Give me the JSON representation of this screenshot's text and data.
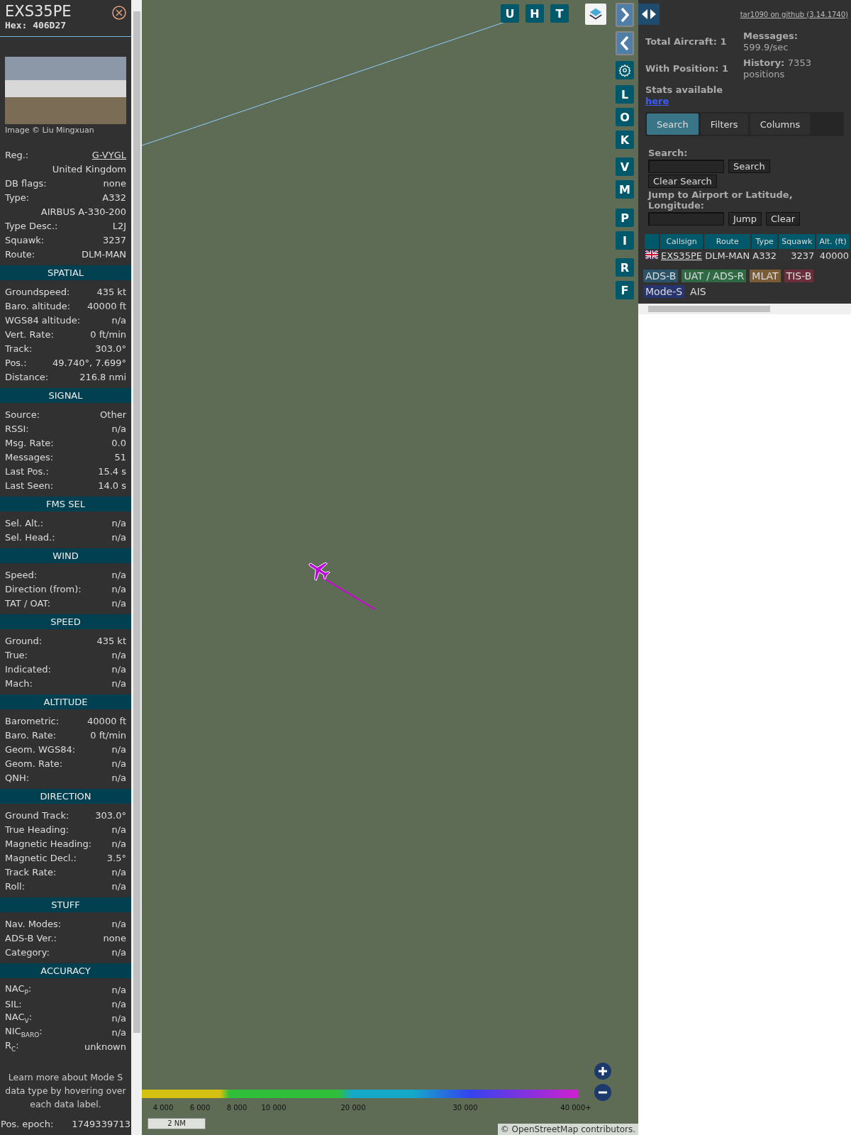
{
  "aircraft": {
    "callsign": "EXS35PE",
    "hex_label": "Hex:",
    "hex": "406D27",
    "photo_credit": "Image © Liu Mingxuan",
    "info_rows": [
      {
        "label": "Reg.:",
        "value": "G-VYGL",
        "kind": "link"
      },
      {
        "value": "United Kingdom",
        "kind": "text"
      },
      {
        "label": "DB flags:",
        "value": "none",
        "kind": "text"
      },
      {
        "label": "Type:",
        "value": "A332",
        "kind": "text"
      },
      {
        "value": "AIRBUS A-330-200",
        "kind": "text"
      },
      {
        "label": "Type Desc.:",
        "value": "L2J",
        "kind": "text"
      },
      {
        "label": "Squawk:",
        "value": "3237",
        "kind": "text"
      },
      {
        "label": "Route:",
        "value": "DLM-MAN",
        "kind": "text"
      }
    ],
    "sections": [
      {
        "title": "SPATIAL",
        "rows": [
          {
            "label": "Groundspeed:",
            "value": "435 kt"
          },
          {
            "label": "Baro. altitude:",
            "value": "40000 ft"
          },
          {
            "label": "WGS84 altitude:",
            "value": "n/a"
          },
          {
            "label": "Vert. Rate:",
            "value": "0 ft/min"
          },
          {
            "label": "Track:",
            "value": "303.0°"
          },
          {
            "label": "Pos.:",
            "value": "49.740°, 7.699°"
          },
          {
            "label": "Distance:",
            "value": "216.8 nmi"
          }
        ]
      },
      {
        "title": "SIGNAL",
        "rows": [
          {
            "label": "Source:",
            "value": "Other"
          },
          {
            "label": "RSSI:",
            "value": "n/a"
          },
          {
            "label": "Msg. Rate:",
            "value": "0.0"
          },
          {
            "label": "Messages:",
            "value": "51"
          },
          {
            "label": "Last Pos.:",
            "value": "15.4 s"
          },
          {
            "label": "Last Seen:",
            "value": "14.0 s"
          }
        ]
      },
      {
        "title": "FMS SEL",
        "rows": [
          {
            "label": "Sel. Alt.:",
            "value": "n/a"
          },
          {
            "label": "Sel. Head.:",
            "value": "n/a"
          }
        ]
      },
      {
        "title": "WIND",
        "rows": [
          {
            "label": "Speed:",
            "value": "n/a"
          },
          {
            "label": "Direction (from):",
            "value": "n/a"
          },
          {
            "label": "TAT / OAT:",
            "value": "n/a"
          }
        ]
      },
      {
        "title": "SPEED",
        "rows": [
          {
            "label": "Ground:",
            "value": "435 kt"
          },
          {
            "label": "True:",
            "value": "n/a"
          },
          {
            "label": "Indicated:",
            "value": "n/a"
          },
          {
            "label": "Mach:",
            "value": "n/a"
          }
        ]
      },
      {
        "title": "ALTITUDE",
        "rows": [
          {
            "label": "Barometric:",
            "value": "40000 ft"
          },
          {
            "label": "Baro. Rate:",
            "value": "0 ft/min"
          },
          {
            "label": "Geom. WGS84:",
            "value": "n/a"
          },
          {
            "label": "Geom. Rate:",
            "value": "n/a"
          },
          {
            "label": "QNH:",
            "value": "n/a"
          }
        ]
      },
      {
        "title": "DIRECTION",
        "rows": [
          {
            "label": "Ground Track:",
            "value": "303.0°"
          },
          {
            "label": "True Heading:",
            "value": "n/a"
          },
          {
            "label": "Magnetic Heading:",
            "value": "n/a"
          },
          {
            "label": "Magnetic Decl.:",
            "value": "3.5°"
          },
          {
            "label": "Track Rate:",
            "value": "n/a"
          },
          {
            "label": "Roll:",
            "value": "n/a"
          }
        ]
      },
      {
        "title": "STUFF",
        "rows": [
          {
            "label": "Nav. Modes:",
            "value": "n/a"
          },
          {
            "label": "ADS-B Ver.:",
            "value": "none"
          },
          {
            "label": "Category:",
            "value": "n/a"
          }
        ]
      },
      {
        "title": "ACCURACY",
        "rows": [
          {
            "label": "NAC$_{P}$:",
            "value": "n/a"
          },
          {
            "label": "SIL:",
            "value": "n/a"
          },
          {
            "label": "NAC$_{V}$:",
            "value": "n/a"
          },
          {
            "label": "NIC$_{BARO}$:",
            "value": "n/a"
          },
          {
            "label": "R$_{C}$:",
            "value": "unknown"
          }
        ]
      }
    ],
    "note": "Learn more about Mode S data type by hovering over each data label.",
    "footer": {
      "label": "Pos. epoch:",
      "value": "1749339713"
    }
  },
  "map": {
    "top_buttons": [
      "U",
      "H",
      "T"
    ],
    "side_buttons": [
      {
        "kind": "icon"
      },
      {
        "kind": "icon"
      },
      {
        "kind": "gear"
      },
      {
        "label": "L",
        "kind": "letter"
      },
      {
        "label": "O",
        "kind": "letter"
      },
      {
        "label": "K",
        "kind": "letter"
      },
      {
        "label": "V",
        "kind": "letter"
      },
      {
        "label": "M",
        "kind": "letter"
      },
      {
        "label": "P",
        "kind": "letter"
      },
      {
        "label": "I",
        "kind": "letter"
      },
      {
        "label": "R",
        "kind": "letter"
      },
      {
        "label": "F",
        "kind": "letter"
      }
    ],
    "altitude_scale": [
      "4 000",
      "6 000",
      "8 000",
      "10 000",
      "20 000",
      "30 000",
      "40 000+"
    ],
    "scale_bar": "2 NM",
    "attribution_prefix": "©",
    "attribution_link": "OpenStreetMap",
    "attribution_suffix": "contributors."
  },
  "sidebar": {
    "github_link": "tar1090 on github (3.14.1740)",
    "stats": [
      {
        "label": "Total Aircraft:",
        "value": "1"
      },
      {
        "label": "With Position:",
        "value": "1"
      },
      {
        "label": "Messages:",
        "value": "599.9/sec"
      },
      {
        "label": "History:",
        "value": "7353 positions"
      }
    ],
    "stats_note": "Stats available",
    "stats_link": "here",
    "tabs": [
      {
        "label": "Search",
        "selected": true
      },
      {
        "label": "Filters",
        "selected": false
      },
      {
        "label": "Columns",
        "selected": false
      }
    ],
    "search_label": "Search:",
    "search_button": "Search",
    "clear_search_button": "Clear Search",
    "jump_label": "Jump to Airport or Latitude, Longitude:",
    "jump_button": "Jump",
    "clear_button": "Clear",
    "table": {
      "columns": [
        "Callsign",
        "Route",
        "Type",
        "Squawk",
        "Alt. (ft)"
      ],
      "rows": [
        {
          "callsign": "EXS35PE",
          "route": "DLM-MAN",
          "type": "A332",
          "squawk": "3237",
          "altitude": "40000"
        }
      ]
    },
    "legend": [
      {
        "label": "ADS-B",
        "color": "#2b5468"
      },
      {
        "label": "UAT / ADS-R",
        "color": "#2f6a45"
      },
      {
        "label": "MLAT",
        "color": "#7a5c37"
      },
      {
        "label": "TIS-B",
        "color": "#6a2f3a"
      },
      {
        "label": "Mode-S",
        "color": "#27346e"
      },
      {
        "label": "AIS"
      }
    ]
  }
}
